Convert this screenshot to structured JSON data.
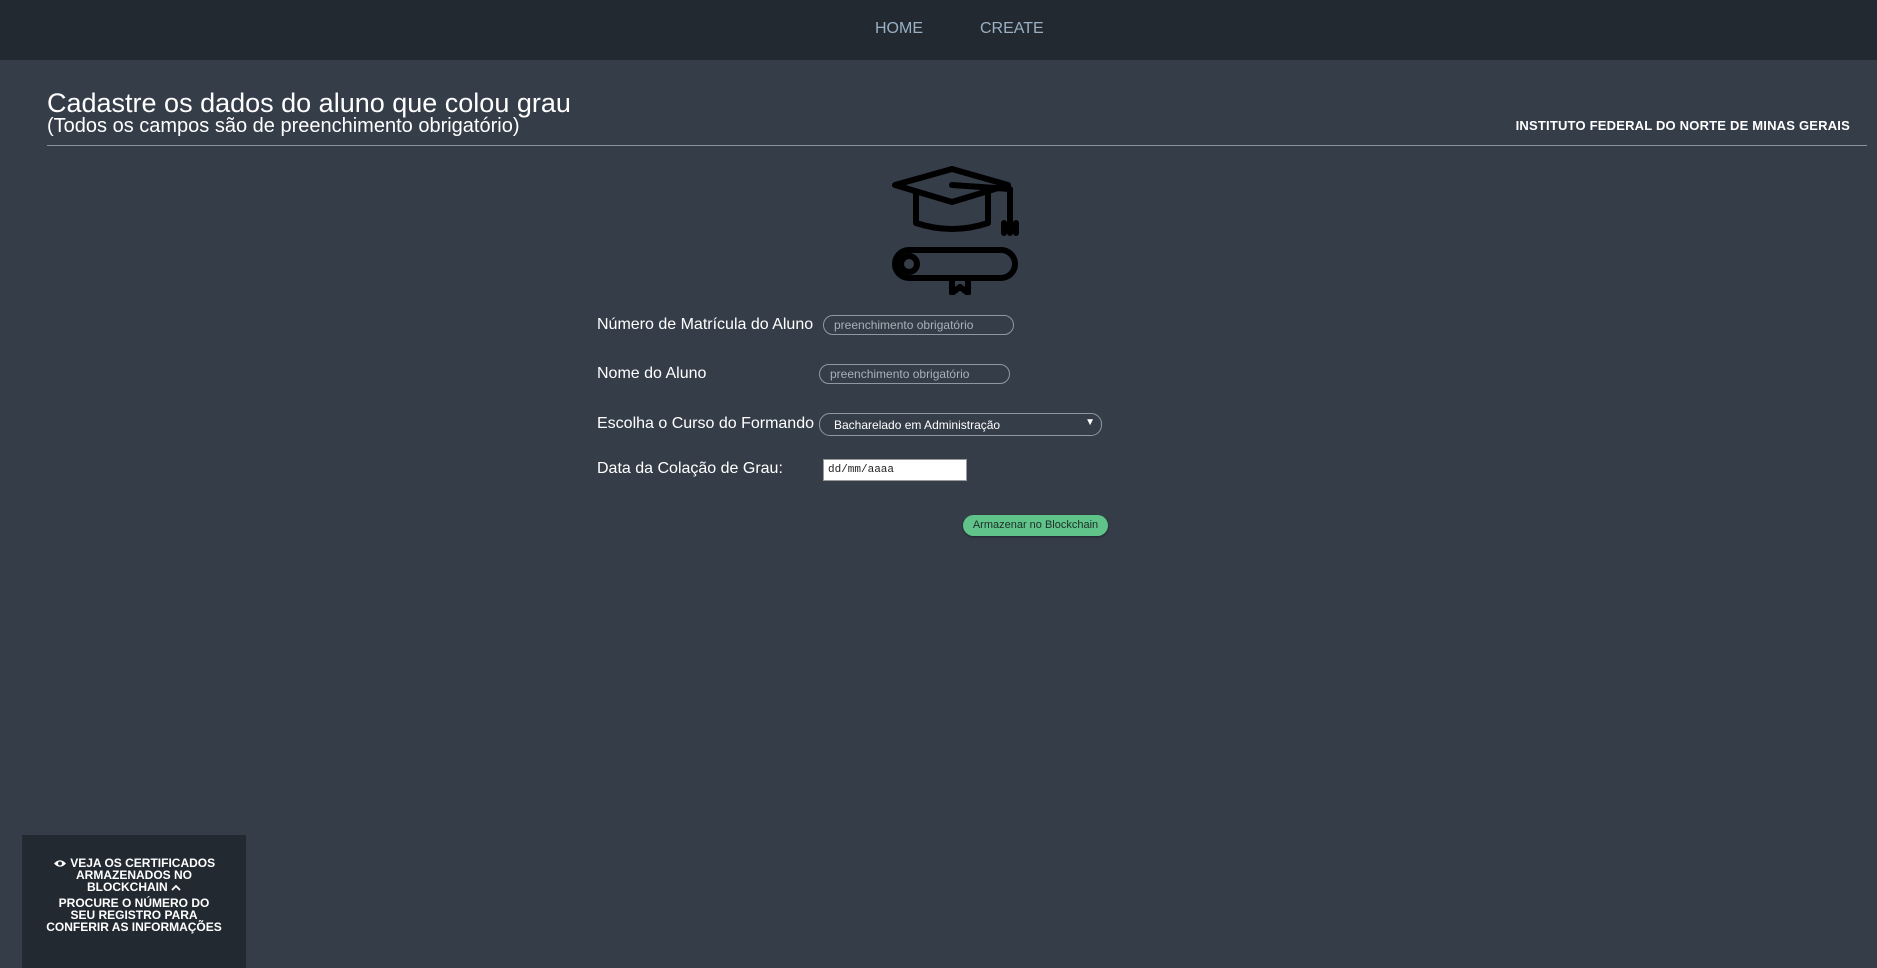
{
  "nav": {
    "home": "HOME",
    "create": "CREATE"
  },
  "header": {
    "title": "Cadastre os dados do aluno que colou grau",
    "subtitle": "(Todos os campos são de preenchimento obrigatório)",
    "institution": "INSTITUTO FEDERAL DO NORTE DE MINAS GERAIS"
  },
  "emblem_icon": "graduation-cap-diploma-icon",
  "form": {
    "registration_label": "Número de Matrícula do Aluno",
    "registration_placeholder": "preenchimento obrigatório",
    "name_label": "Nome do Aluno",
    "name_placeholder": "preenchimento obrigatório",
    "course_label": "Escolha o Curso do Formando",
    "course_selected": "Bacharelado em Administração",
    "date_label": "Data da Colação de Grau:",
    "date_placeholder": "dd/mm/aaaa",
    "submit_label": "Armazenar no Blockchain"
  },
  "side_panel": {
    "toggle_label": "VEJA OS CERTIFICADOS ARMAZENADOS NO BLOCKCHAIN",
    "info_text": "PROCURE O NÚMERO DO SEU REGISTRO PARA CONFERIR AS INFORMAÇÕES"
  },
  "colors": {
    "background": "#353d49",
    "nav_background": "#232931",
    "accent_button": "#5fc38a"
  }
}
